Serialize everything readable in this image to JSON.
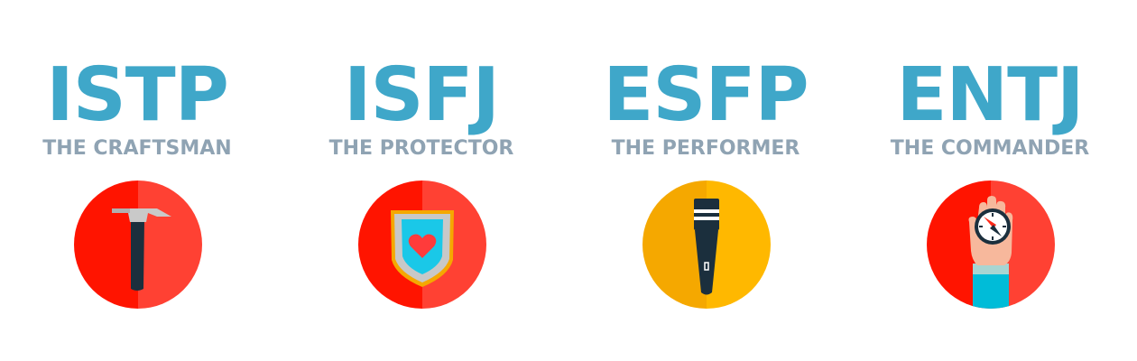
{
  "types": [
    {
      "code": "ISTP",
      "nickname": "THE CRAFTSMAN",
      "icon": "hammer-icon",
      "circle_colors": [
        "#ff1400",
        "#ff4133"
      ]
    },
    {
      "code": "ISFJ",
      "nickname": "THE PROTECTOR",
      "icon": "heart-shield-icon",
      "circle_colors": [
        "#ff1400",
        "#ff4133"
      ]
    },
    {
      "code": "ESFP",
      "nickname": "THE PERFORMER",
      "icon": "microphone-icon",
      "circle_colors": [
        "#f5a800",
        "#ffb800"
      ]
    },
    {
      "code": "ENTJ",
      "nickname": "THE COMMANDER",
      "icon": "hand-compass-icon",
      "circle_colors": [
        "#ff1400",
        "#ff4133"
      ]
    }
  ],
  "colors": {
    "code_text": "#3fa7c9",
    "nickname_text": "#8fa3b3",
    "background": "#ffffff"
  }
}
